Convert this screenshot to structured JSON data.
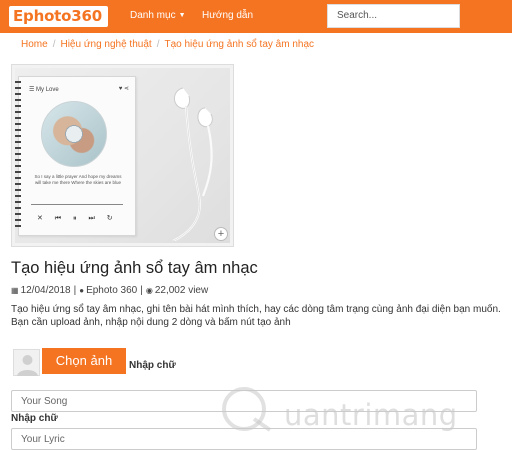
{
  "header": {
    "logo": "Ephoto360",
    "nav": [
      "Danh mục",
      "Hướng dẫn"
    ],
    "search_placeholder": "Search..."
  },
  "breadcrumb": [
    "Home",
    "Hiệu ứng nghệ thuật",
    "Tạo hiệu ứng ảnh sổ tay âm nhạc"
  ],
  "preview": {
    "song_title": "My Love",
    "lyrics": "So I say a little prayer And hope my dreams will take me there Where the skies are blue"
  },
  "page": {
    "title": "Tạo hiệu ứng ảnh sổ tay âm nhạc",
    "date": "12/04/2018",
    "author": "Ephoto 360",
    "views": "22,002 view",
    "description": "Tạo hiệu ứng sổ tay âm nhạc, ghi tên bài hát mình thích, hay các dòng tâm trạng cùng ảnh đại diện bạn muốn. Bạn cần upload ảnh, nhập nội dung 2 dòng và bấm nút tạo ảnh"
  },
  "form": {
    "upload_button": "Chọn ảnh",
    "input_label": "Nhập chữ",
    "field1_placeholder": "Your Song",
    "field2_placeholder": "Your Lyric"
  },
  "watermark": "uantrimang"
}
